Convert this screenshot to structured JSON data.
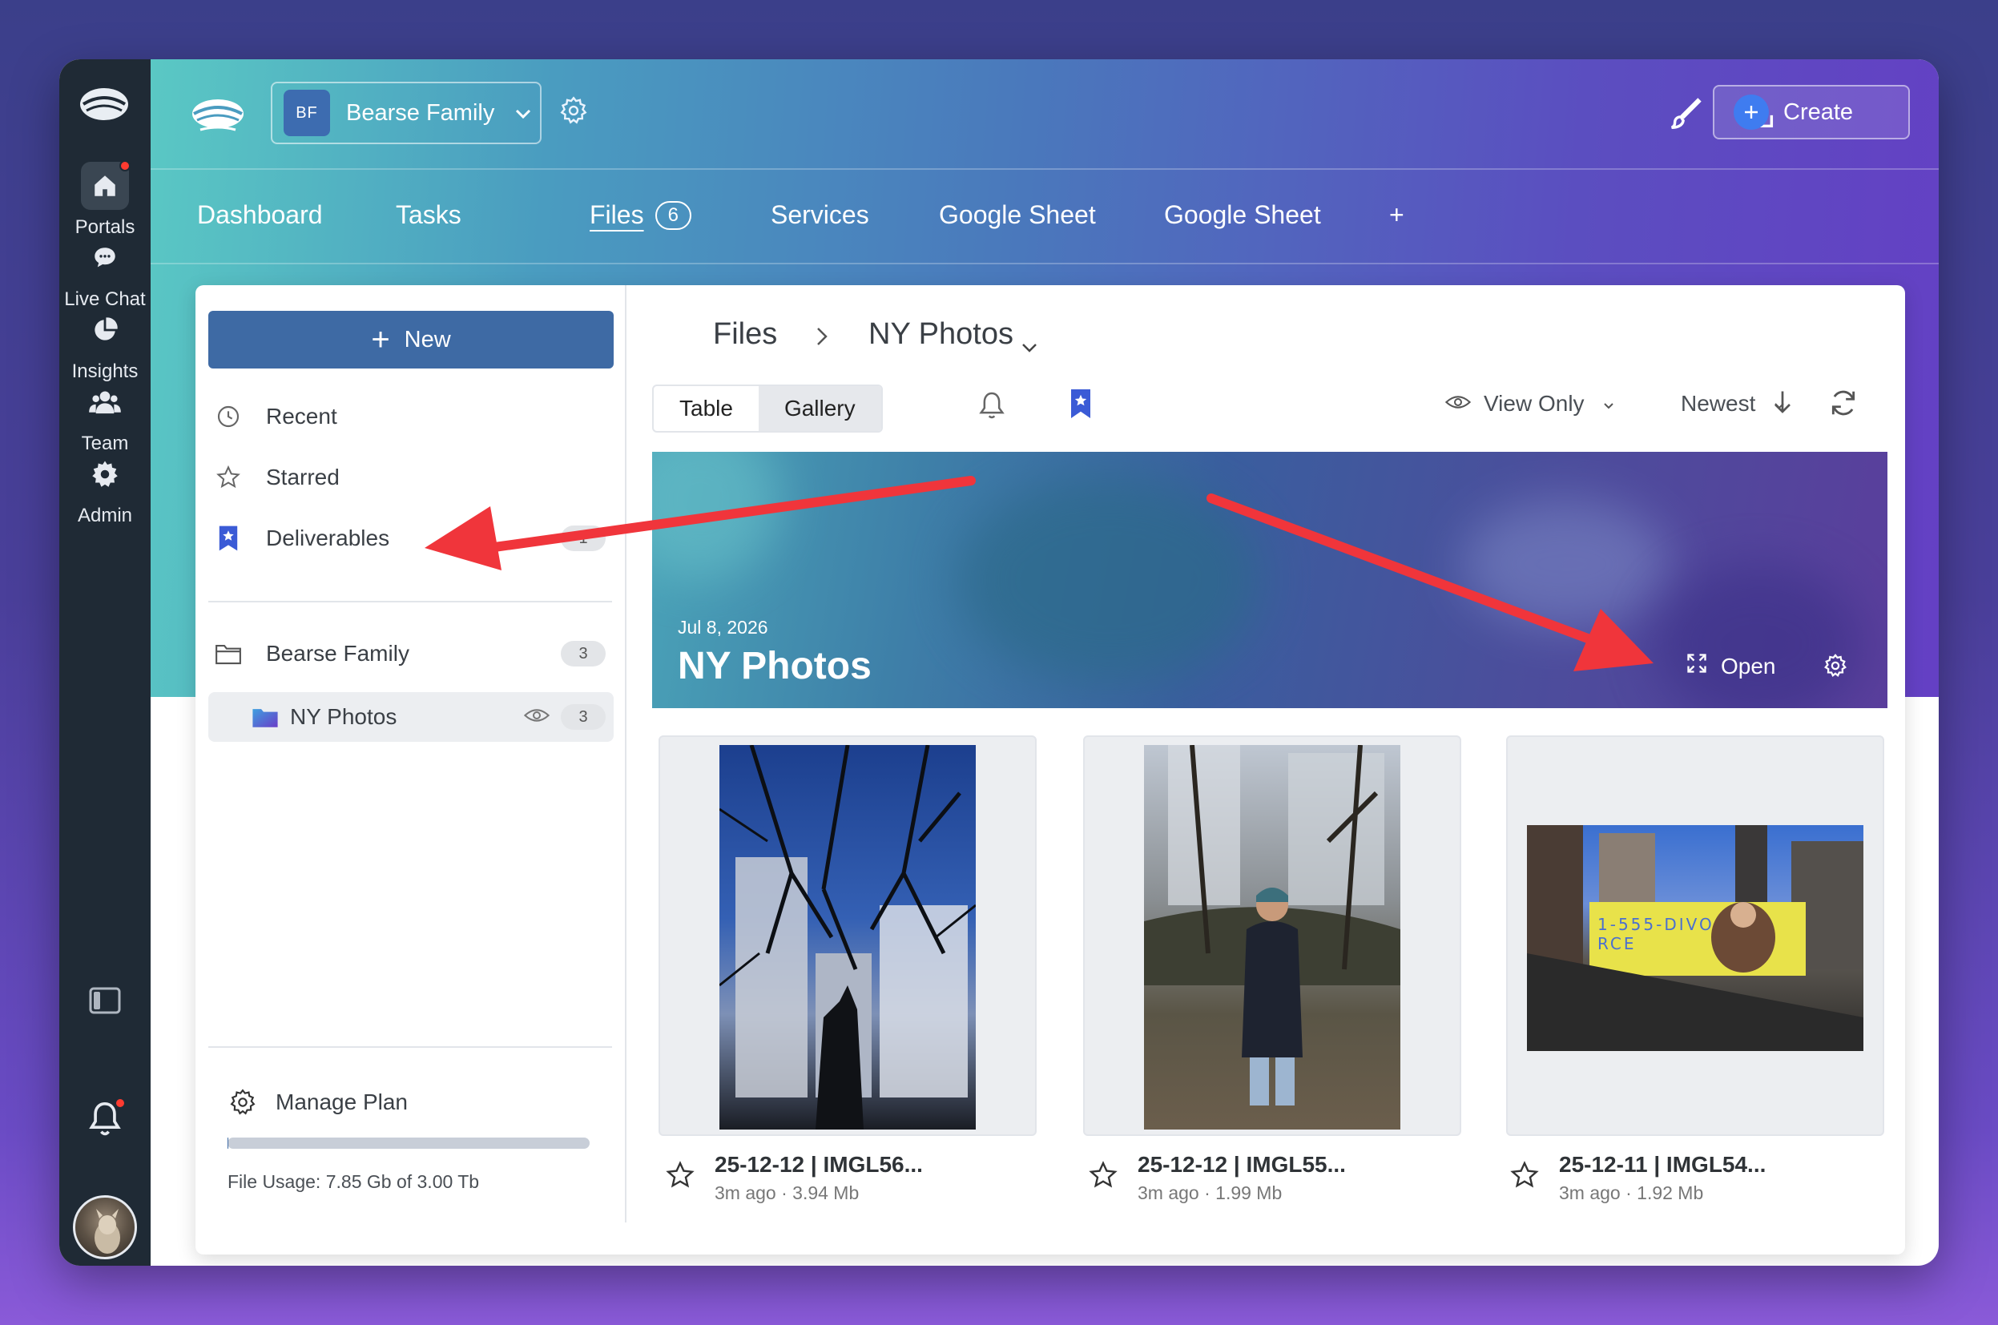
{
  "rail": {
    "items": [
      {
        "label": "Portals",
        "icon": "home-icon"
      },
      {
        "label": "Live Chat",
        "icon": "chat-icon"
      },
      {
        "label": "Insights",
        "icon": "pie-chart-icon"
      },
      {
        "label": "Team",
        "icon": "team-icon"
      },
      {
        "label": "Admin",
        "icon": "gear-icon"
      }
    ]
  },
  "header": {
    "portal": {
      "badge": "BF",
      "name": "Bearse Family"
    },
    "create_label": "Create"
  },
  "tabs": [
    {
      "label": "Dashboard"
    },
    {
      "label": "Tasks"
    },
    {
      "label": "Files",
      "count": "6"
    },
    {
      "label": "Services"
    },
    {
      "label": "Google Sheet"
    },
    {
      "label": "Google Sheet"
    },
    {
      "label": "+"
    }
  ],
  "sidebar": {
    "new_label": "New",
    "nav": [
      {
        "label": "Recent",
        "icon": "clock-icon"
      },
      {
        "label": "Starred",
        "icon": "star-icon"
      },
      {
        "label": "Deliverables",
        "icon": "bookmark-star-icon",
        "count": "1"
      }
    ],
    "folders": [
      {
        "label": "Bearse Family",
        "count": "3"
      },
      {
        "label": "NY Photos",
        "count": "3"
      }
    ],
    "manage_plan": "Manage Plan",
    "usage_fraction": 0.0026,
    "usage_text": "File Usage: 7.85 Gb of 3.00 Tb"
  },
  "content": {
    "breadcrumb_root": "Files",
    "breadcrumb_current": "NY Photos",
    "view_tabs": [
      "Table",
      "Gallery"
    ],
    "active_view": "Gallery",
    "permission": "View Only",
    "sort": "Newest",
    "banner": {
      "date": "Jul 8, 2026",
      "title": "NY Photos",
      "open_label": "Open"
    },
    "files": [
      {
        "name": "25-12-12 | IMGL56...",
        "meta": "3m ago · 3.94 Mb"
      },
      {
        "name": "25-12-12 | IMGL55...",
        "meta": "3m ago · 1.99 Mb"
      },
      {
        "name": "25-12-11 | IMGL54...",
        "meta": "3m ago · 1.92 Mb"
      }
    ],
    "billboard_text": [
      "1-555-DIVO",
      "RCE"
    ]
  },
  "colors": {
    "rail_bg": "#1f2a35",
    "new_button": "#3e6aa4",
    "annotation_arrow": "#f0353b",
    "notification_dot": "#ff3b30"
  }
}
